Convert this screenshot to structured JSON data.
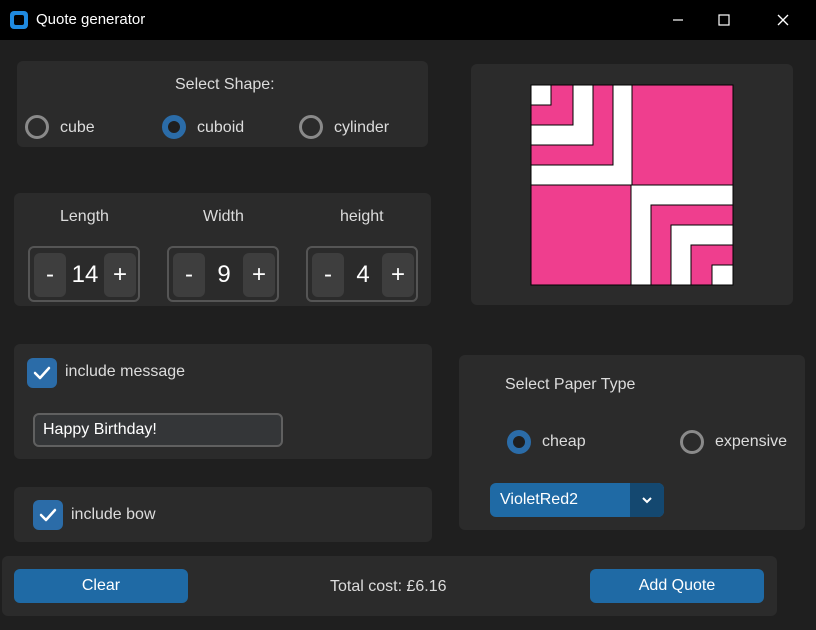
{
  "window": {
    "title": "Quote generator",
    "minimize_glyph": "—",
    "maximize_glyph": "☐",
    "close_glyph": "✕"
  },
  "shape": {
    "title": "Select Shape:",
    "options": [
      {
        "label": "cube",
        "selected": false
      },
      {
        "label": "cuboid",
        "selected": true
      },
      {
        "label": "cylinder",
        "selected": false
      }
    ]
  },
  "dimensions": {
    "length": {
      "label": "Length",
      "value": "14"
    },
    "width": {
      "label": "Width",
      "value": "9"
    },
    "height": {
      "label": "height",
      "value": "4"
    },
    "minus_label": "-",
    "plus_label": "+"
  },
  "message": {
    "checkbox_label": "include message",
    "checked": true,
    "input_value": "Happy Birthday!"
  },
  "bow": {
    "checkbox_label": "include bow",
    "checked": true
  },
  "paper": {
    "title": "Select Paper Type",
    "options": [
      {
        "label": "cheap",
        "selected": true
      },
      {
        "label": "expensive",
        "selected": false
      }
    ],
    "color_select": {
      "value": "VioletRed2"
    }
  },
  "preview": {
    "pattern_color": "#ef3e8e",
    "background_color": "#ffffff"
  },
  "footer": {
    "clear_label": "Clear",
    "total_cost": "Total cost: £6.16",
    "add_quote_label": "Add Quote"
  },
  "colors": {
    "accent": "#1f6aa5",
    "panel": "#2b2b2b",
    "background": "#1f1f1f"
  }
}
